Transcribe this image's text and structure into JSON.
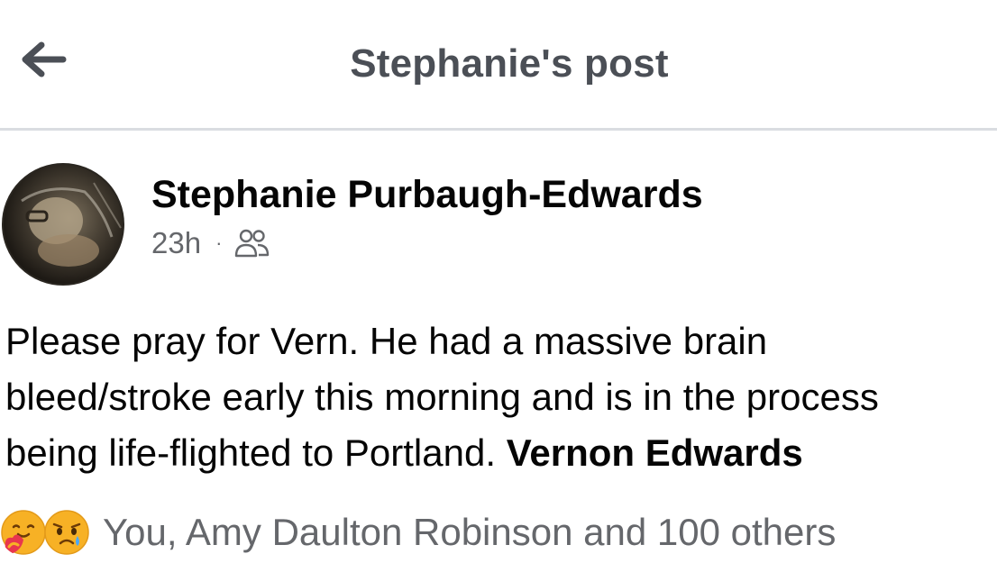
{
  "header": {
    "title": "Stephanie's post",
    "back_icon": "back-arrow-icon"
  },
  "post": {
    "author": "Stephanie Purbaugh-Edwards",
    "timestamp": "23h",
    "separator": "·",
    "audience_icon": "friends-icon",
    "text_lines": [
      "Please pray for Vern. He had a massive brain",
      "bleed/stroke early this morning and is in the process",
      "being life-flighted to Portland. "
    ],
    "mention": "Vernon Edwards",
    "reactions": {
      "icons": [
        "care-reaction-icon",
        "sad-reaction-icon"
      ],
      "summary": "You, Amy Daulton Robinson and 100 others"
    }
  },
  "colors": {
    "header_text": "#4b4f56",
    "secondary_text": "#65676b",
    "divider": "#dadde1"
  }
}
